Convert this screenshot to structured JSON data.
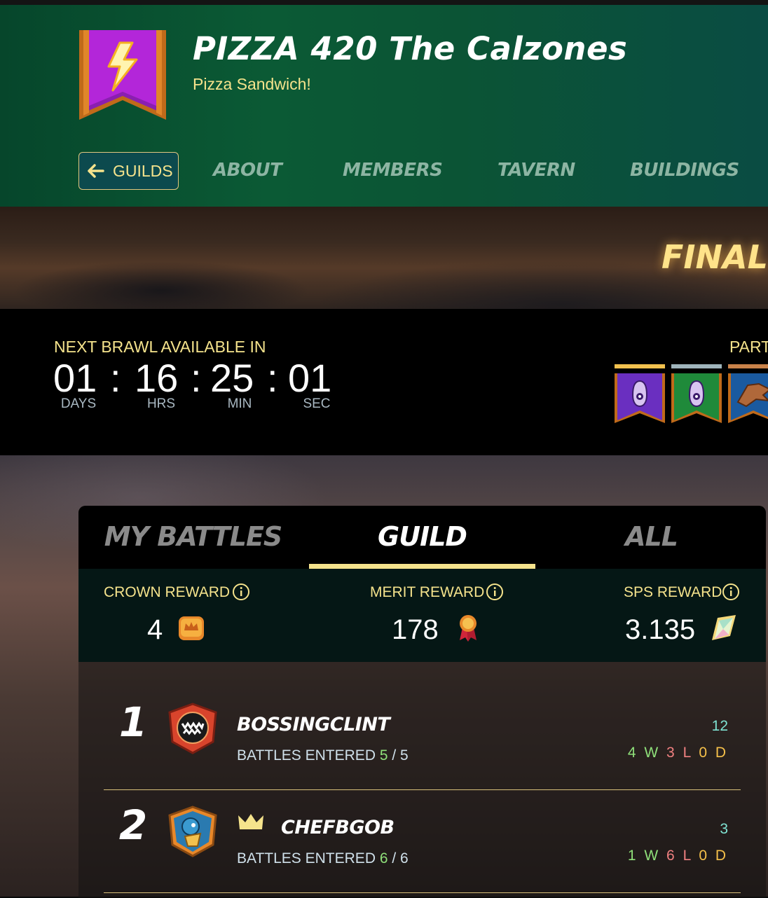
{
  "header": {
    "guild_name": "PIZZA 420 The Calzones",
    "motto": "Pizza Sandwich!",
    "back_button": "GUILDS",
    "nav": [
      "ABOUT",
      "MEMBERS",
      "TAVERN",
      "BUILDINGS"
    ],
    "banner_icon": "lightning-bolt-icon"
  },
  "hero": {
    "title": "FINAL"
  },
  "countdown": {
    "label": "NEXT BRAWL AVAILABLE IN",
    "days": "01",
    "hours": "16",
    "minutes": "25",
    "seconds": "01",
    "units": [
      "DAYS",
      "HRS",
      "MIN",
      "SEC"
    ],
    "participants_label": "PART"
  },
  "tabs": [
    "MY BATTLES",
    "GUILD",
    "ALL"
  ],
  "active_tab": "GUILD",
  "rewards": {
    "crown": {
      "label": "CROWN REWARD",
      "value": "4"
    },
    "merit": {
      "label": "MERIT REWARD",
      "value": "178"
    },
    "sps": {
      "label": "SPS REWARD",
      "value": "3.135"
    }
  },
  "battles_entered_label": "BATTLES ENTERED",
  "players": [
    {
      "rank": "1",
      "name": "BOSSINGCLINT",
      "entered": "5",
      "total": "5",
      "score": "12",
      "wins": "4",
      "losses": "3",
      "draws": "0",
      "avatar": "monster-mouth-avatar-icon"
    },
    {
      "rank": "2",
      "name": "CHEFBGOB",
      "entered": "6",
      "total": "6",
      "score": "3",
      "wins": "1",
      "losses": "6",
      "draws": "0",
      "avatar": "sea-creature-avatar-icon",
      "has_crown": true
    }
  ],
  "colors": {
    "accent_gold": "#f5e38c",
    "win_green": "#8fe07a",
    "loss_red": "#f08080",
    "draw_orange": "#f5c04a"
  }
}
